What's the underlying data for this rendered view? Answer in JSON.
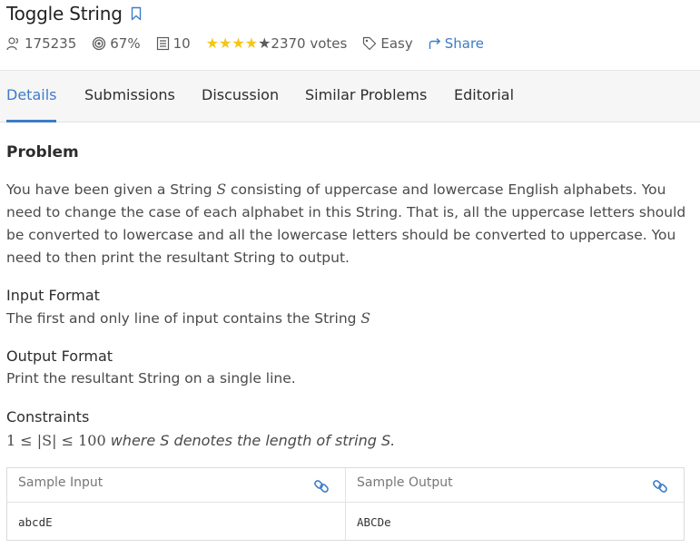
{
  "problem": {
    "title": "Toggle String",
    "meta": {
      "submissions_count": "175235",
      "success_rate": "67%",
      "count": "10",
      "votes": "2370 votes",
      "difficulty": "Easy",
      "share_label": "Share",
      "rating_stars": 4.5
    }
  },
  "tabs": [
    "Details",
    "Submissions",
    "Discussion",
    "Similar Problems",
    "Editorial"
  ],
  "active_tab": "Details",
  "content": {
    "heading": "Problem",
    "desc_1": "You have been given a String ",
    "desc_var": "S",
    "desc_2": " consisting of uppercase and lowercase English alphabets. You need to change the case of each alphabet in this String. That is, all the uppercase letters should be converted to lowercase and all the lowercase letters should be converted to uppercase. You need to then print the resultant String to output.",
    "input_format_title": "Input Format",
    "input_format_text": "The first and only line of input contains the String ",
    "input_format_var": "S",
    "output_format_title": "Output Format",
    "output_format_text": "Print the resultant String on a single line.",
    "constraints_title": "Constraints",
    "constraint_math": "1 ≤ |S| ≤ 100",
    "constraint_text": " where S denotes the length of string S."
  },
  "samples": {
    "input_header": "Sample Input",
    "output_header": "Sample Output",
    "input_value": "abcdE",
    "output_value": "ABCDe"
  },
  "colors": {
    "accent": "#3e7cc7",
    "star": "#f5c518",
    "text": "#2d2d2d",
    "muted": "#5b5b5b"
  }
}
